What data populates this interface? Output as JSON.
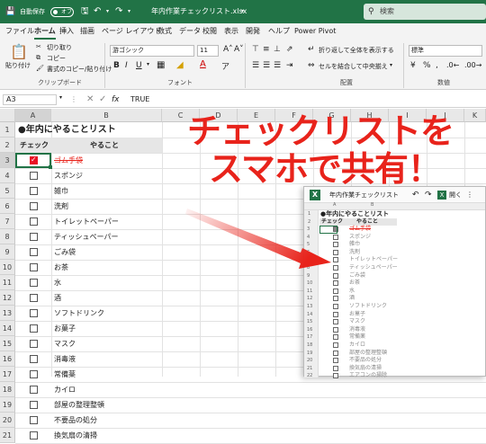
{
  "titlebar": {
    "autosave_label": "自動保存",
    "autosave_state": "オフ",
    "filename": "年内作業チェックリスト.xlsx",
    "search_placeholder": "検索",
    "bg_color": "#217346"
  },
  "menu": [
    "ファイル",
    "ホーム",
    "挿入",
    "描画",
    "ページ レイアウト",
    "数式",
    "データ",
    "校閲",
    "表示",
    "開発",
    "ヘルプ",
    "Power Pivot"
  ],
  "menu_active": "ホーム",
  "ribbon": {
    "paste_label": "貼り付け",
    "cut_label": "切り取り",
    "copy_label": "コピー",
    "format_painter_label": "書式のコピー/貼り付け",
    "clipboard_group": "クリップボード",
    "font_name": "游ゴシック",
    "font_size": "11",
    "bold": "B",
    "italic": "I",
    "underline": "U",
    "font_group": "フォント",
    "wrap_text_label": "折り返して全体を表示する",
    "merge_label": "セルを結合して中央揃え",
    "alignment_group": "配置",
    "number_format": "標準",
    "number_group": "数値"
  },
  "formula_bar": {
    "name_box": "A3",
    "fx": "fx",
    "value": "TRUE"
  },
  "columns": [
    "A",
    "B",
    "C",
    "D",
    "E",
    "F",
    "G",
    "H",
    "I",
    "J",
    "K"
  ],
  "sheet": {
    "title": "●年内にやることリスト",
    "header_check": "チェック",
    "header_todo": "やること",
    "rows": [
      {
        "n": "3",
        "item": "ゴム手袋",
        "checked": true
      },
      {
        "n": "4",
        "item": "スポンジ",
        "checked": false
      },
      {
        "n": "5",
        "item": "雑巾",
        "checked": false
      },
      {
        "n": "6",
        "item": "洗剤",
        "checked": false
      },
      {
        "n": "7",
        "item": "トイレットペーパー",
        "checked": false
      },
      {
        "n": "8",
        "item": "ティッシュペーパー",
        "checked": false
      },
      {
        "n": "9",
        "item": "ごみ袋",
        "checked": false
      },
      {
        "n": "10",
        "item": "お茶",
        "checked": false
      },
      {
        "n": "11",
        "item": "水",
        "checked": false
      },
      {
        "n": "12",
        "item": "酒",
        "checked": false
      },
      {
        "n": "13",
        "item": "ソフトドリンク",
        "checked": false
      },
      {
        "n": "14",
        "item": "お菓子",
        "checked": false
      },
      {
        "n": "15",
        "item": "マスク",
        "checked": false
      },
      {
        "n": "16",
        "item": "消毒液",
        "checked": false
      },
      {
        "n": "17",
        "item": "常備薬",
        "checked": false
      },
      {
        "n": "18",
        "item": "カイロ",
        "checked": false
      },
      {
        "n": "19",
        "item": "部屋の整理整頓",
        "checked": false
      },
      {
        "n": "20",
        "item": "不要品の処分",
        "checked": false
      },
      {
        "n": "21",
        "item": "換気扇の清掃",
        "checked": false
      }
    ]
  },
  "callout": {
    "line1": "チェックリストを",
    "line2": "スマホで共有！",
    "color": "#e8231b"
  },
  "mobile": {
    "title": "年内作業チェックリスト",
    "open_label": "開く",
    "col_a": "A",
    "col_b": "B",
    "title_row": "●年内にやることリスト",
    "header_check": "チェック",
    "header_todo": "やること",
    "rows": [
      {
        "n": "3",
        "item": "ゴム手袋",
        "checked": true
      },
      {
        "n": "4",
        "item": "スポンジ",
        "checked": false
      },
      {
        "n": "5",
        "item": "雑巾",
        "checked": false
      },
      {
        "n": "6",
        "item": "洗剤",
        "checked": false
      },
      {
        "n": "7",
        "item": "トイレットペーパー",
        "checked": false
      },
      {
        "n": "8",
        "item": "ティッシュペーパー",
        "checked": false
      },
      {
        "n": "9",
        "item": "ごみ袋",
        "checked": false
      },
      {
        "n": "10",
        "item": "お茶",
        "checked": false
      },
      {
        "n": "11",
        "item": "水",
        "checked": false
      },
      {
        "n": "12",
        "item": "酒",
        "checked": false
      },
      {
        "n": "13",
        "item": "ソフトドリンク",
        "checked": false
      },
      {
        "n": "14",
        "item": "お菓子",
        "checked": false
      },
      {
        "n": "15",
        "item": "マスク",
        "checked": false
      },
      {
        "n": "16",
        "item": "消毒液",
        "checked": false
      },
      {
        "n": "17",
        "item": "常備薬",
        "checked": false
      },
      {
        "n": "18",
        "item": "カイロ",
        "checked": false
      },
      {
        "n": "19",
        "item": "部屋の整理整頓",
        "checked": false
      },
      {
        "n": "20",
        "item": "不要品の処分",
        "checked": false
      },
      {
        "n": "21",
        "item": "換気扇の清掃",
        "checked": false
      },
      {
        "n": "22",
        "item": "エアコンの掃除",
        "checked": false
      }
    ]
  }
}
